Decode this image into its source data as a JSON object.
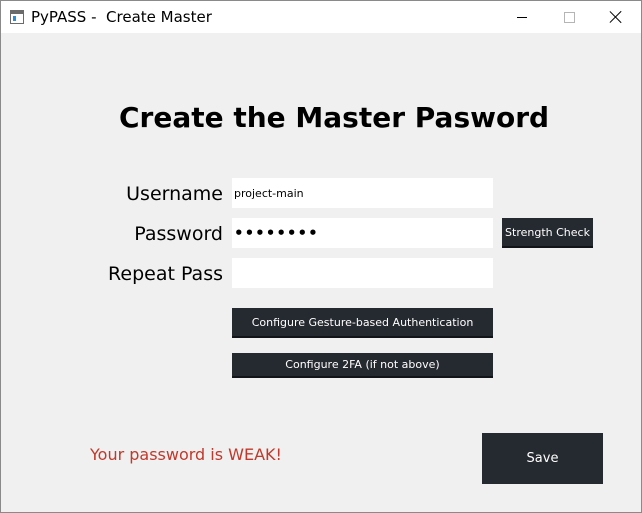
{
  "window": {
    "title": "PyPASS -  Create Master"
  },
  "main": {
    "heading": "Create the Master Pasword",
    "username_label": "Username",
    "username_value": "project-main",
    "password_label": "Password",
    "password_value": "••••••••",
    "repeat_label": "Repeat Pass",
    "repeat_value": "",
    "strength_button": "Strength Check",
    "gesture_button": "Configure Gesture-based Authentication",
    "twofa_button": "Configure 2FA (if not above)",
    "status_text": "Your password is WEAK!",
    "save_button": "Save"
  },
  "colors": {
    "status_text": "#c0392b",
    "button_bg": "#252930",
    "background": "#f0f0f0"
  },
  "icons": {
    "app": "app-window-icon",
    "minimize": "minimize-icon",
    "maximize": "maximize-icon",
    "close": "close-icon"
  }
}
